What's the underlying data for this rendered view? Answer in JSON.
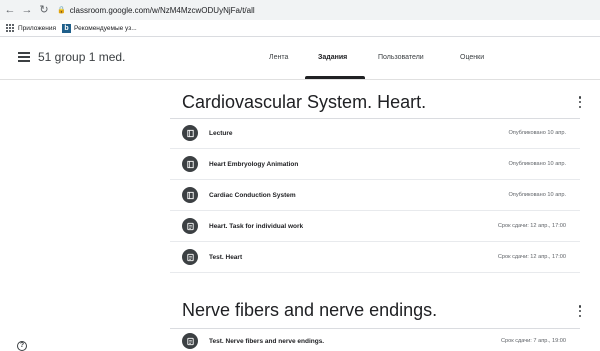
{
  "browser": {
    "back_icon": "arrow-left-icon",
    "forward_icon": "arrow-right-icon",
    "reload_icon": "reload-icon",
    "url": "classroom.google.com/w/NzM4MzcwODUyNjFa/t/all"
  },
  "bookmarks": [
    {
      "label": "Приложения",
      "icon": "apps-grid-icon"
    },
    {
      "label": "Рекомендуемые уз...",
      "icon": "bing-icon"
    }
  ],
  "header": {
    "class_title": "51 group 1 med.",
    "tabs": [
      {
        "label": "Лента",
        "active": false
      },
      {
        "label": "Задания",
        "active": true
      },
      {
        "label": "Пользователи",
        "active": false
      },
      {
        "label": "Оценки",
        "active": false
      }
    ]
  },
  "sections": [
    {
      "title": "Cardiovascular System. Heart.",
      "items": [
        {
          "title": "Lecture",
          "meta": "Опубликовано 10 апр.",
          "icon": "material-book-icon"
        },
        {
          "title": "Heart Embryology Animation",
          "meta": "Опубликовано 10 апр.",
          "icon": "material-book-icon"
        },
        {
          "title": "Cardiac Conduction System",
          "meta": "Опубликовано 10 апр.",
          "icon": "material-book-icon"
        },
        {
          "title": "Heart. Task for individual work",
          "meta": "Срок сдачи: 12 апр., 17:00",
          "icon": "assignment-icon"
        },
        {
          "title": "Test. Heart",
          "meta": "Срок сдачи: 12 апр., 17:00",
          "icon": "assignment-icon"
        }
      ]
    },
    {
      "title": "Nerve fibers and nerve endings.",
      "items": [
        {
          "title": "Test. Nerve fibers and nerve endings.",
          "meta": "Срок сдачи: 7 апр., 19:00",
          "icon": "assignment-icon"
        }
      ]
    }
  ],
  "help_icon": "help-circle-icon",
  "help_label": "?"
}
